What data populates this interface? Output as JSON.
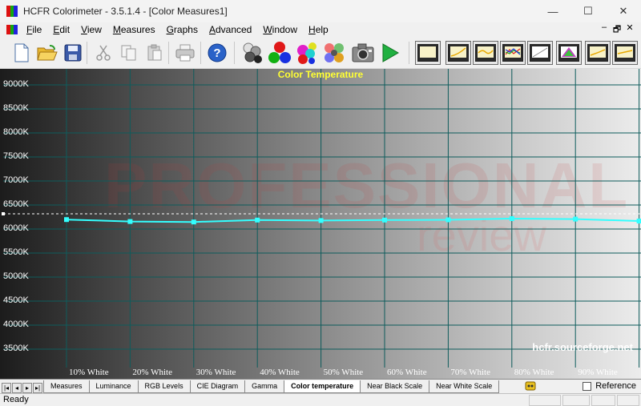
{
  "window": {
    "title": "HCFR Colorimeter - 3.5.1.4 - [Color Measures1]",
    "controls": [
      "—",
      "☐",
      "✕"
    ]
  },
  "menu": {
    "items": [
      {
        "label": "File",
        "mnemonic": "F",
        "rest": "ile"
      },
      {
        "label": "Edit",
        "mnemonic": "E",
        "rest": "dit"
      },
      {
        "label": "View",
        "mnemonic": "V",
        "rest": "iew"
      },
      {
        "label": "Measures",
        "mnemonic": "M",
        "rest": "easures"
      },
      {
        "label": "Graphs",
        "mnemonic": "G",
        "rest": "raphs"
      },
      {
        "label": "Advanced",
        "mnemonic": "A",
        "rest": "dvanced"
      },
      {
        "label": "Window",
        "mnemonic": "W",
        "rest": "indow"
      },
      {
        "label": "Help",
        "mnemonic": "H",
        "rest": "elp"
      }
    ],
    "mdi_controls": [
      "–",
      "🗗",
      "✕"
    ]
  },
  "toolbar": {
    "buttons": [
      "new-document-icon",
      "open-folder-icon",
      "save-disk-icon",
      "cut-icon",
      "copy-icon",
      "paste-icon",
      "print-icon",
      "help-icon",
      "measure-gray-icon",
      "measure-primaries-icon",
      "measure-secondaries-icon",
      "measure-saturation-icon",
      "camera-icon",
      "play-icon"
    ],
    "chart_buttons": [
      "luminance-chart-icon",
      "gamma-chart-icon",
      "rgb-chart-icon",
      "temperature-chart-icon",
      "cie-chart-icon",
      "near-black-chart-icon",
      "near-white-chart-icon"
    ]
  },
  "chart_data": {
    "type": "line",
    "title": "Color Temperature",
    "ylim": [
      3200,
      9400
    ],
    "yticks": [
      "9000K",
      "8500K",
      "8000K",
      "7500K",
      "7000K",
      "6500K",
      "6000K",
      "5500K",
      "5000K",
      "4500K",
      "4000K",
      "3500K"
    ],
    "ytick_values": [
      9000,
      8500,
      8000,
      7500,
      7000,
      6500,
      6000,
      5500,
      5000,
      4500,
      4000,
      3500
    ],
    "categories": [
      "10% White",
      "20% White",
      "30% White",
      "40% White",
      "50% White",
      "60% White",
      "70% White",
      "80% White",
      "90% White",
      "100% White"
    ],
    "series": [
      {
        "values": [
          6380,
          6340,
          6330,
          6370,
          6360,
          6370,
          6375,
          6400,
          6390,
          6350
        ],
        "color": "#33ffff"
      }
    ],
    "reference_value": 6500,
    "grid": true,
    "grid_color": "#0e5c5c",
    "watermark": "hcfr.sourceforge.net"
  },
  "tabs": {
    "items": [
      "Measures",
      "Luminance",
      "RGB Levels",
      "CIE Diagram",
      "Gamma",
      "Color temperature",
      "Near Black Scale",
      "Near White Scale"
    ],
    "active": "Color temperature",
    "reference_label": "Reference"
  },
  "status": {
    "text": "Ready"
  }
}
